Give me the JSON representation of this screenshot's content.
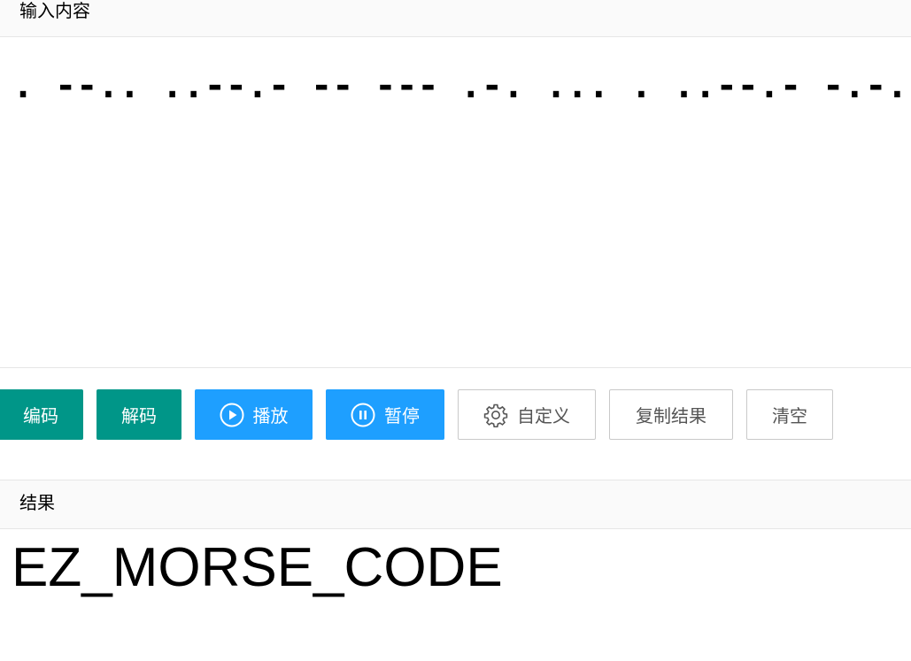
{
  "input": {
    "header": "输入内容",
    "value": ". --.. ..--.- -- --- .-. ... . ..--.- -.-. --- -.. ."
  },
  "toolbar": {
    "encode_label": "编码",
    "decode_label": "解码",
    "play_label": "播放",
    "pause_label": "暂停",
    "custom_label": "自定义",
    "copy_label": "复制结果",
    "clear_label": "清空"
  },
  "icons": {
    "play": "play-circle-icon",
    "pause": "pause-circle-icon",
    "custom": "gear-icon"
  },
  "colors": {
    "primary": "#009688",
    "normal": "#1e9fff",
    "plain_border": "#c9c9c9"
  },
  "result": {
    "header": "结果",
    "value": "EZ_MORSE_CODE"
  }
}
